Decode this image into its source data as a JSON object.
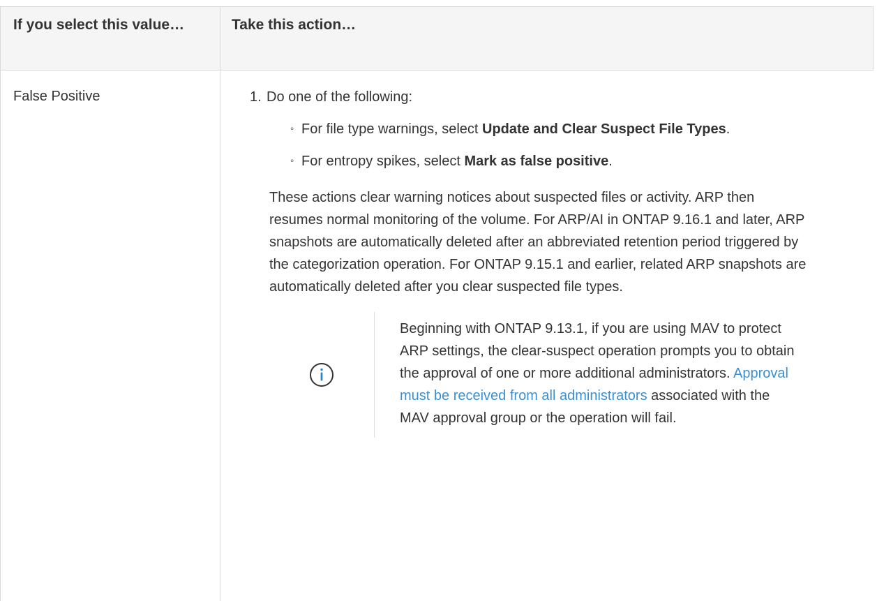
{
  "table": {
    "headers": [
      "If you select this value…",
      "Take this action…"
    ],
    "row": {
      "value": "False Positive",
      "step": {
        "number": "1.",
        "text": "Do one of the following:"
      },
      "options": [
        {
          "prefix": "For file type warnings, select ",
          "bold": "Update and Clear Suspect File Types",
          "suffix": "."
        },
        {
          "prefix": "For entropy spikes, select ",
          "bold": "Mark as false positive",
          "suffix": "."
        }
      ],
      "paragraph": "These actions clear warning notices about suspected files or activity. ARP then resumes normal monitoring of the volume. For ARP/AI in ONTAP 9.16.1 and later, ARP snapshots are automatically deleted after an abbreviated retention period triggered by the categorization operation. For ONTAP 9.15.1 and earlier, related ARP snapshots are automatically deleted after you clear suspected file types.",
      "note": {
        "icon": "info-circle-icon",
        "before_link": "Beginning with ONTAP 9.13.1, if you are using MAV to protect ARP settings, the clear-suspect operation prompts you to obtain the approval of one or more additional administrators. ",
        "link": "Approval must be received from all administrators",
        "after_link": " associated with the MAV approval group or the operation will fail."
      }
    }
  },
  "colors": {
    "text": "#333333",
    "link": "#3b8fd0",
    "header_bg": "#f5f5f5",
    "border": "#d9d9d9"
  }
}
